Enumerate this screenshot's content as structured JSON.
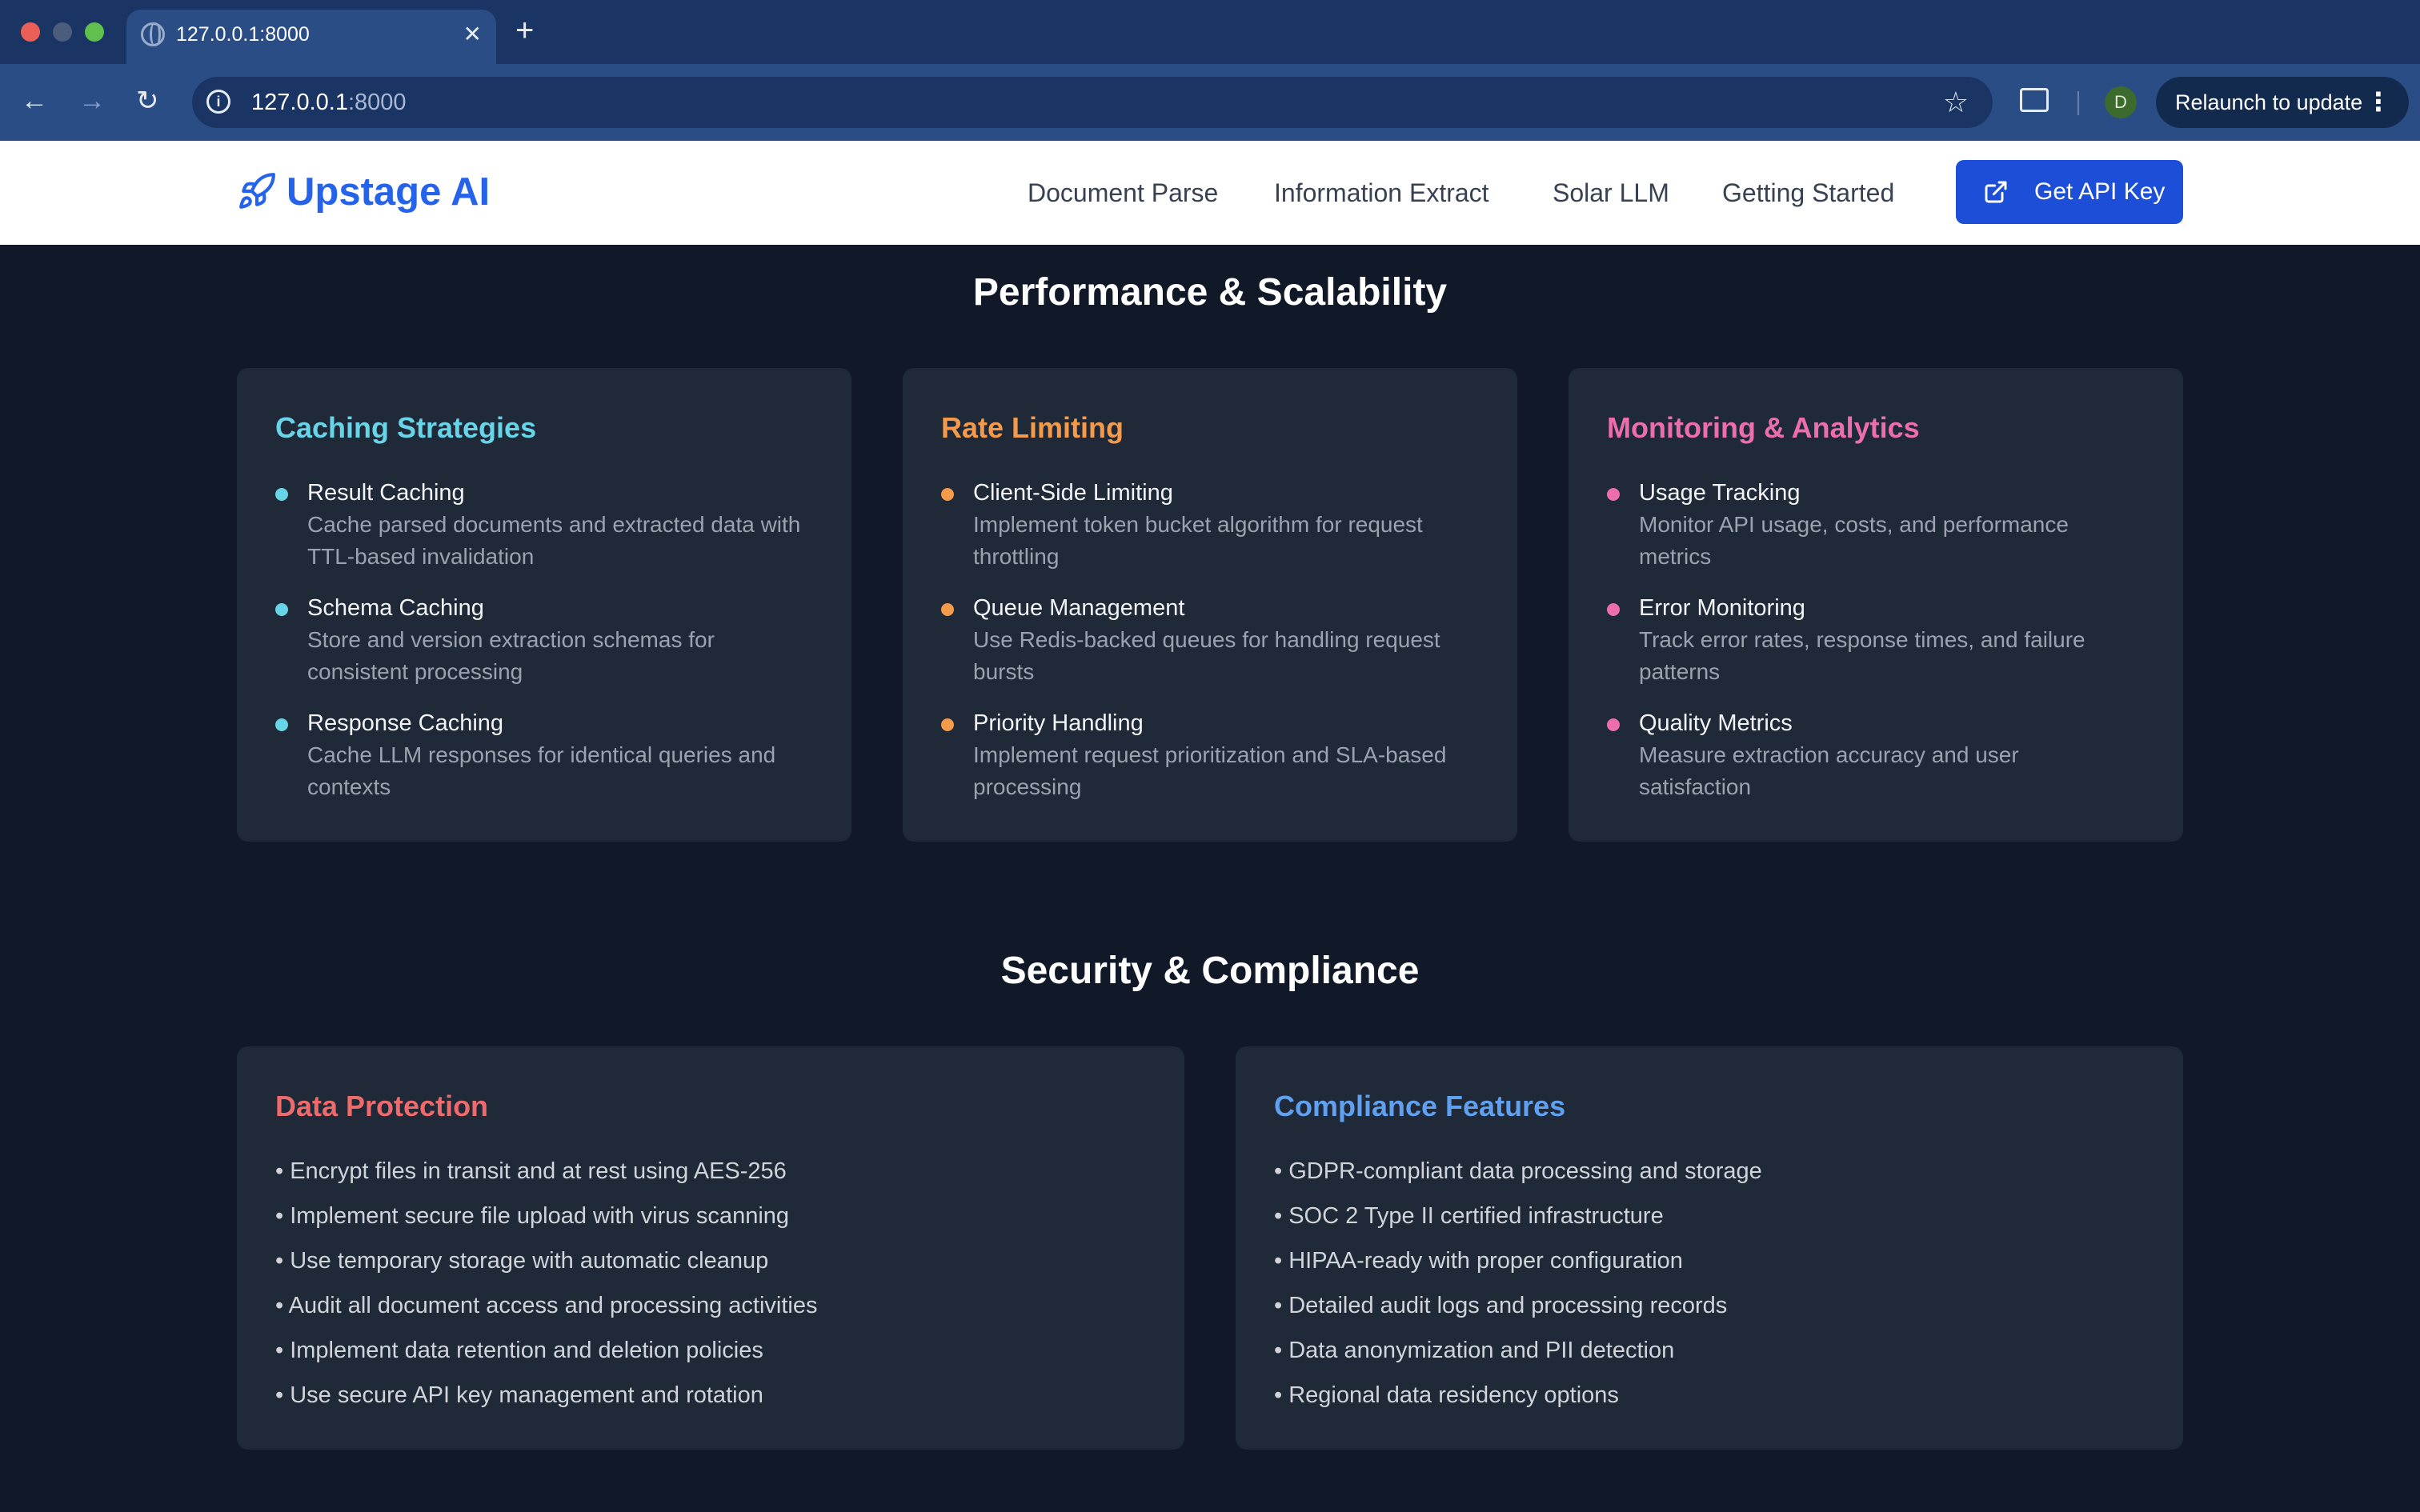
{
  "browser": {
    "tab_title": "127.0.0.1:8000",
    "tab_close": "✕",
    "new_tab": "+",
    "url_host": "127.0.0.1",
    "url_port": ":8000",
    "profile_initial": "D",
    "relaunch_label": "Relaunch to update",
    "icons": {
      "back": "←",
      "forward": "→",
      "reload": "↻",
      "star": "☆",
      "menu": "⋮",
      "info": "i"
    }
  },
  "header": {
    "logo_text": "Upstage AI",
    "nav": [
      "Document Parse",
      "Information Extract",
      "Solar LLM",
      "Getting Started"
    ],
    "cta_label": "Get API Key"
  },
  "performance": {
    "title": "Performance & Scalability",
    "cards": [
      {
        "title": "Caching Strategies",
        "color": "#67d4e8",
        "items": [
          {
            "title": "Result Caching",
            "desc": "Cache parsed documents and extracted data with TTL-based invalidation"
          },
          {
            "title": "Schema Caching",
            "desc": "Store and version extraction schemas for consistent processing"
          },
          {
            "title": "Response Caching",
            "desc": "Cache LLM responses for identical queries and contexts"
          }
        ]
      },
      {
        "title": "Rate Limiting",
        "color": "#f59a4b",
        "items": [
          {
            "title": "Client-Side Limiting",
            "desc": "Implement token bucket algorithm for request throttling"
          },
          {
            "title": "Queue Management",
            "desc": "Use Redis-backed queues for handling request bursts"
          },
          {
            "title": "Priority Handling",
            "desc": "Implement request prioritization and SLA-based processing"
          }
        ]
      },
      {
        "title": "Monitoring & Analytics",
        "color": "#ec6fab",
        "items": [
          {
            "title": "Usage Tracking",
            "desc": "Monitor API usage, costs, and performance metrics"
          },
          {
            "title": "Error Monitoring",
            "desc": "Track error rates, response times, and failure patterns"
          },
          {
            "title": "Quality Metrics",
            "desc": "Measure extraction accuracy and user satisfaction"
          }
        ]
      }
    ]
  },
  "security": {
    "title": "Security & Compliance",
    "cards": [
      {
        "title": "Data Protection",
        "color": "#ef6b6b",
        "bullets": [
          "• Encrypt files in transit and at rest using AES-256",
          "• Implement secure file upload with virus scanning",
          "• Use temporary storage with automatic cleanup",
          "• Audit all document access and processing activities",
          "• Implement data retention and deletion policies",
          "• Use secure API key management and rotation"
        ]
      },
      {
        "title": "Compliance Features",
        "color": "#60a0f0",
        "bullets": [
          "• GDPR-compliant data processing and storage",
          "• SOC 2 Type II certified infrastructure",
          "• HIPAA-ready with proper configuration",
          "• Detailed audit logs and processing records",
          "• Data anonymization and PII detection",
          "• Regional data residency options"
        ]
      }
    ]
  }
}
